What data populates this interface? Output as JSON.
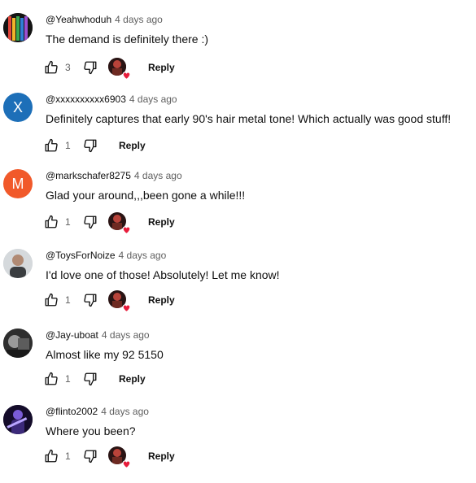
{
  "colors": {
    "heart": "#e81c3b",
    "time": "#606060",
    "avatar_x": "#1d6fb8",
    "avatar_m": "#f1592a"
  },
  "comments": [
    {
      "author": "@Yeahwhoduh",
      "time": "4 days ago",
      "text": "The demand is definitely there :)",
      "likes": "3",
      "reply": "Reply",
      "hearted": true,
      "avatar": "guitar-photo"
    },
    {
      "author": "@xxxxxxxxxx6903",
      "time": "4 days ago",
      "text": "Definitely captures that early 90's hair metal tone!  Which actually was good stuff!",
      "likes": "1",
      "reply": "Reply",
      "hearted": false,
      "avatar": "letter",
      "letter": "X"
    },
    {
      "author": "@markschafer8275",
      "time": "4 days ago",
      "text": "Glad your around,,,been gone a while!!!",
      "likes": "1",
      "reply": "Reply",
      "hearted": true,
      "avatar": "letter",
      "letter": "M"
    },
    {
      "author": "@ToysForNoize",
      "time": "4 days ago",
      "text": "I'd love one of those! Absolutely! Let me know!",
      "likes": "1",
      "reply": "Reply",
      "hearted": true,
      "avatar": "person-photo"
    },
    {
      "author": "@Jay-uboat",
      "time": "4 days ago",
      "text": "Almost like my 92 5150",
      "likes": "1",
      "reply": "Reply",
      "hearted": false,
      "avatar": "mono-photo"
    },
    {
      "author": "@flinto2002",
      "time": "4 days ago",
      "text": "Where you been?",
      "likes": "1",
      "reply": "Reply",
      "hearted": true,
      "avatar": "stage-photo"
    }
  ]
}
